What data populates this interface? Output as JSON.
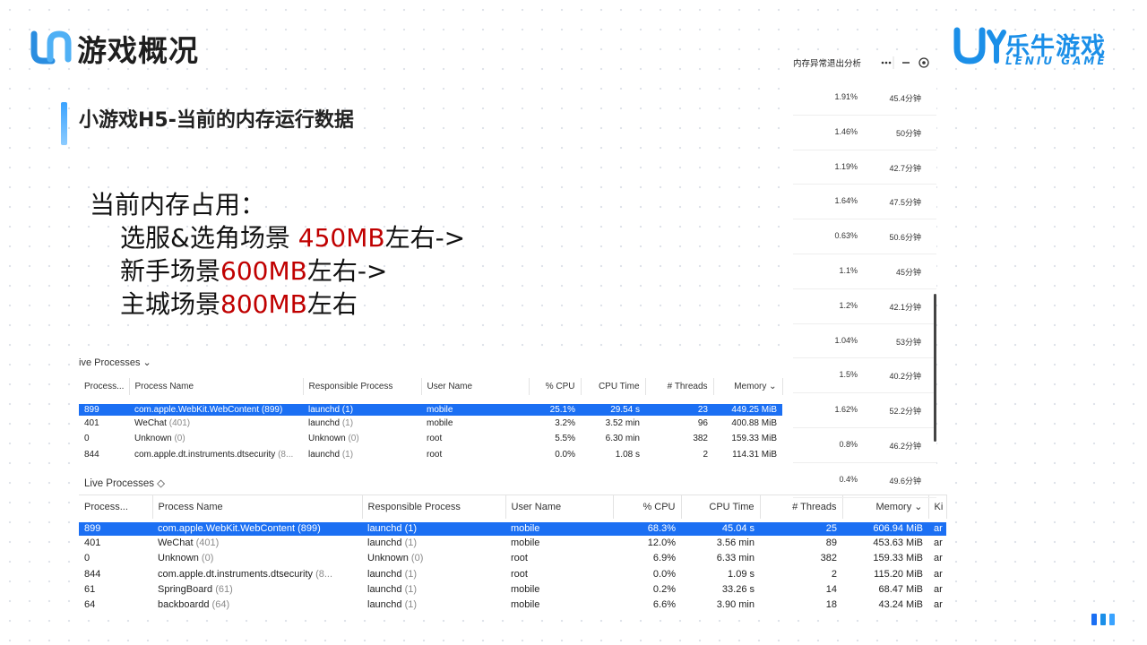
{
  "header": {
    "title": "游戏概况",
    "brand_name": "乐牛游戏",
    "brand_sub": "LENIU GAME"
  },
  "section": {
    "title": "小游戏H5-当前的内存运行数据"
  },
  "memory_summary": {
    "heading": "当前内存占用：",
    "lines": [
      {
        "prefix": "选服&选角场景 ",
        "value": "450MB",
        "suffix": "左右->"
      },
      {
        "prefix": "新手场景",
        "value": "600MB",
        "suffix": "左右->"
      },
      {
        "prefix": "主城场景",
        "value": "800MB",
        "suffix": "左右"
      }
    ]
  },
  "top_table": {
    "title": "ive Processes ⌄",
    "columns": [
      "Process...",
      "Process Name",
      "Responsible Process",
      "User Name",
      "% CPU",
      "CPU Time",
      "# Threads",
      "Memory ⌄"
    ],
    "rows": [
      {
        "pid": "899",
        "name": "com.apple.WebKit.WebContent (899)",
        "name_paren": "",
        "resp": "launchd (1)",
        "resp_paren": "",
        "user": "mobile",
        "cpu": "25.1%",
        "time": "29.54 s",
        "threads": "23",
        "mem": "449.25 MiB",
        "selected": true
      },
      {
        "pid": "401",
        "name": "WeChat ",
        "name_paren": "(401)",
        "resp": "launchd ",
        "resp_paren": "(1)",
        "user": "mobile",
        "cpu": "3.2%",
        "time": "3.52 min",
        "threads": "96",
        "mem": "400.88 MiB",
        "selected": false
      },
      {
        "pid": "0",
        "name": "Unknown ",
        "name_paren": "(0)",
        "resp": "Unknown ",
        "resp_paren": "(0)",
        "user": "root",
        "cpu": "5.5%",
        "time": "6.30 min",
        "threads": "382",
        "mem": "159.33 MiB",
        "selected": false
      },
      {
        "pid": "844",
        "name": "com.apple.dt.instruments.dtsecurity ",
        "name_paren": "(8...",
        "resp": "launchd ",
        "resp_paren": "(1)",
        "user": "root",
        "cpu": "0.0%",
        "time": "1.08 s",
        "threads": "2",
        "mem": "114.31 MiB",
        "selected": false
      }
    ]
  },
  "bottom_table": {
    "title": "Live Processes ◇",
    "columns": [
      "Process...",
      "Process Name",
      "Responsible Process",
      "User Name",
      "% CPU",
      "CPU Time",
      "# Threads",
      "Memory ⌄",
      "Ki"
    ],
    "rows": [
      {
        "pid": "899",
        "name": "com.apple.WebKit.WebContent (899)",
        "name_paren": "",
        "resp": "launchd (1)",
        "resp_paren": "",
        "user": "mobile",
        "cpu": "68.3%",
        "time": "45.04 s",
        "threads": "25",
        "mem": "606.94 MiB",
        "kind": "ar",
        "selected": true
      },
      {
        "pid": "401",
        "name": "WeChat ",
        "name_paren": "(401)",
        "resp": "launchd ",
        "resp_paren": "(1)",
        "user": "mobile",
        "cpu": "12.0%",
        "time": "3.56 min",
        "threads": "89",
        "mem": "453.63 MiB",
        "kind": "ar",
        "selected": false
      },
      {
        "pid": "0",
        "name": "Unknown ",
        "name_paren": "(0)",
        "resp": "Unknown ",
        "resp_paren": "(0)",
        "user": "root",
        "cpu": "6.9%",
        "time": "6.33 min",
        "threads": "382",
        "mem": "159.33 MiB",
        "kind": "ar",
        "selected": false
      },
      {
        "pid": "844",
        "name": "com.apple.dt.instruments.dtsecurity ",
        "name_paren": "(8...",
        "resp": "launchd ",
        "resp_paren": "(1)",
        "user": "root",
        "cpu": "0.0%",
        "time": "1.09 s",
        "threads": "2",
        "mem": "115.20 MiB",
        "kind": "ar",
        "selected": false
      },
      {
        "pid": "61",
        "name": "SpringBoard ",
        "name_paren": "(61)",
        "resp": "launchd ",
        "resp_paren": "(1)",
        "user": "mobile",
        "cpu": "0.2%",
        "time": "33.26 s",
        "threads": "14",
        "mem": "68.47 MiB",
        "kind": "ar",
        "selected": false
      },
      {
        "pid": "64",
        "name": "backboardd ",
        "name_paren": "(64)",
        "resp": "launchd ",
        "resp_paren": "(1)",
        "user": "mobile",
        "cpu": "6.6%",
        "time": "3.90 min",
        "threads": "18",
        "mem": "43.24 MiB",
        "kind": "ar",
        "selected": false
      }
    ]
  },
  "side_panel": {
    "title": "内存异常退出分析",
    "rows": [
      {
        "pct": "1.91%",
        "dur": "45.4分钟"
      },
      {
        "pct": "1.46%",
        "dur": "50分钟"
      },
      {
        "pct": "1.19%",
        "dur": "42.7分钟"
      },
      {
        "pct": "1.64%",
        "dur": "47.5分钟"
      },
      {
        "pct": "0.63%",
        "dur": "50.6分钟"
      },
      {
        "pct": "1.1%",
        "dur": "45分钟"
      },
      {
        "pct": "1.2%",
        "dur": "42.1分钟"
      },
      {
        "pct": "1.04%",
        "dur": "53分钟"
      },
      {
        "pct": "1.5%",
        "dur": "40.2分钟"
      },
      {
        "pct": "1.62%",
        "dur": "52.2分钟"
      },
      {
        "pct": "0.8%",
        "dur": "46.2分钟"
      },
      {
        "pct": "0.4%",
        "dur": "49.6分钟"
      }
    ]
  },
  "colors": {
    "accent": "#1b8fe8",
    "selected_row": "#1b6ff3",
    "highlight_value": "#c00000"
  }
}
